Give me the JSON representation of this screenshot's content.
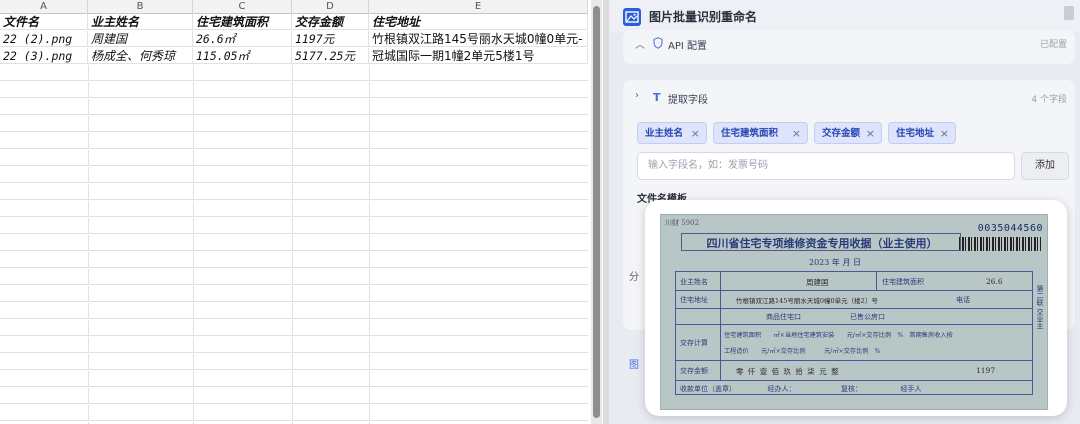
{
  "spreadsheet": {
    "columns": [
      "A",
      "B",
      "C",
      "D",
      "E"
    ],
    "header": [
      "文件名",
      "业主姓名",
      "住宅建筑面积",
      "交存金额",
      "住宅地址"
    ],
    "rows": [
      [
        "22 (2).png",
        "周建国",
        "26.6㎡",
        "1197元",
        "竹根镇双江路145号丽水天城0幢0单元-"
      ],
      [
        "22 (3).png",
        "杨成全、何秀琼",
        "115.05㎡",
        "5177.25元",
        "冠城国际一期1幢2单元5楼1号"
      ]
    ]
  },
  "panel": {
    "title": "图片批量识别重命名",
    "api_label": "API 配置",
    "api_status": "已配置",
    "fields_label": "提取字段",
    "fields_count": "4 个字段",
    "tags": [
      "业主姓名",
      "住宅建筑面积",
      "交存金额",
      "住宅地址"
    ],
    "field_input_placeholder": "输入字段名，如：发票号码",
    "add_button": "添加",
    "template_label": "文件名模板",
    "frag_1": "分",
    "frag_2": "图"
  },
  "receipt": {
    "copy_no": "川财 5902",
    "serial": "0035044560",
    "title": "四川省住宅专项维修资金专用收据（业主使用）",
    "year": "2023 年 月 日",
    "owner_label": "业主姓名",
    "owner_value": "周建国",
    "area_label": "住宅建筑面积",
    "area_value": "26.6",
    "address_label": "住宅地址",
    "address_value": "竹根镇双江路145号丽水天城0幢0单元（楼2）号",
    "phone_label": "电话",
    "type_options": "商品住宅口　　　　　　　已售公房口",
    "calc_label": "交存计算",
    "calc_row1": "住宅建筑面积　　㎡×当地住宅建筑安装　　元/㎡×交存比例　%　首期售房收入按",
    "calc_row2": "工程造价　　元/㎡×交存比例　　　元/㎡×交存比例　%",
    "amount_label": "交存金额",
    "amount_words": "零 仟 壹 佰 玖 拾 柒 元 整",
    "amount_value": "1197",
    "footer": "收款单位（盖章）　　　　　经办人：　　　　　　　复核：　　　　　　经手人",
    "side_text": "第二联 交业主"
  },
  "colors": {
    "tag_bg": "#dde4fb",
    "tag_text": "#2746b0",
    "receipt_ink": "#2a3a7a",
    "brand_icon": "#2b5fd9"
  }
}
